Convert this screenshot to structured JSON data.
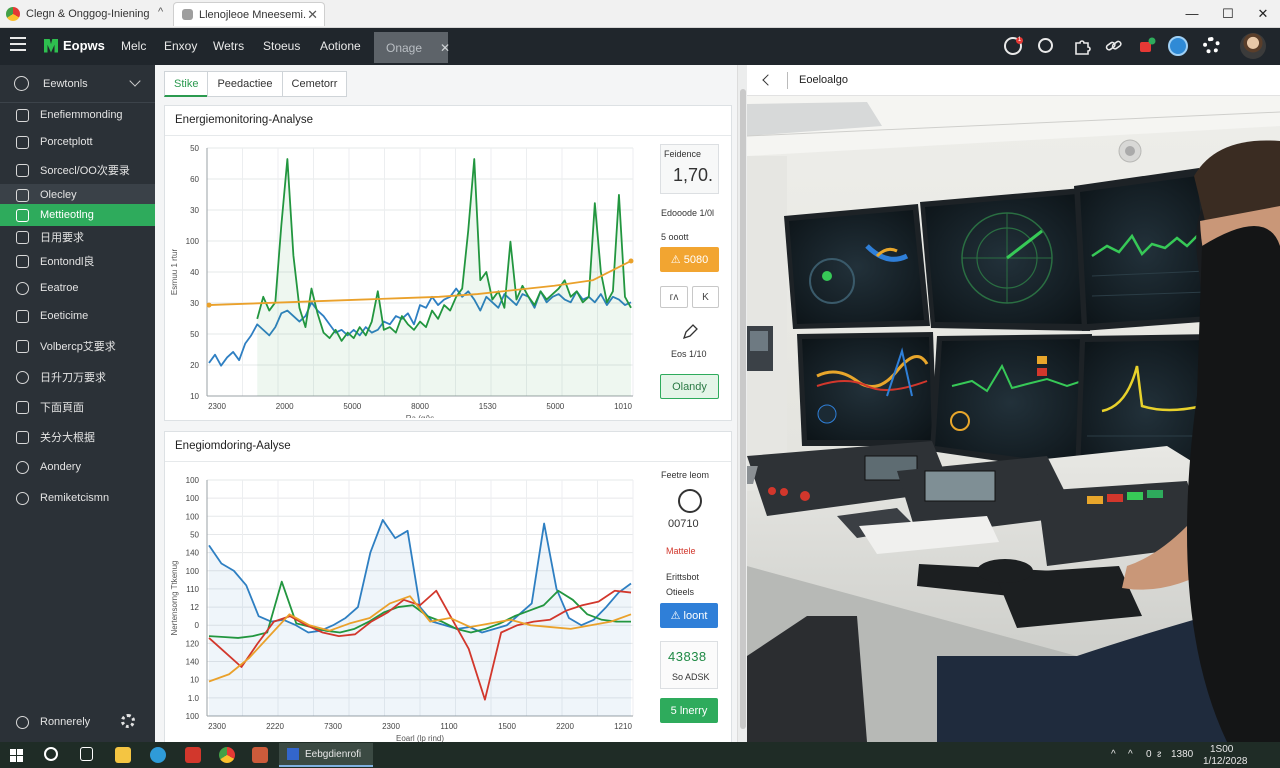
{
  "browser": {
    "tab1_title": "Clegn &  Onggog-Iniening",
    "tab2_title": "Llenojleoe Mneesemi.",
    "caret": "^",
    "window_controls": [
      "—",
      "☐",
      "✕"
    ]
  },
  "appbar": {
    "brand": "Eopws",
    "nav": [
      "Melc",
      "Enxoy",
      "Wetrs",
      "Stoeus",
      "Aotione"
    ],
    "active_tab": "Onage",
    "active_tab_close": "✕",
    "notification_badge": "1"
  },
  "sidebar": {
    "header": "Eewtonls",
    "items": [
      {
        "label": "Enefiemmonding",
        "icon": "pen-icon"
      },
      {
        "label": "Porcetplott",
        "icon": "chart-icon"
      },
      {
        "label": "Sorcecl/OO次要录",
        "icon": "list-icon"
      },
      {
        "label": "Olecley",
        "icon": "bell-icon"
      },
      {
        "label": "Mettieotlng",
        "icon": "monitor-icon"
      },
      {
        "label": "日用要求",
        "icon": "table-icon"
      },
      {
        "label": "Eontondl良",
        "icon": "doc-icon"
      },
      {
        "label": "Eeatroe",
        "icon": "globe-icon"
      },
      {
        "label": "Eoeticime",
        "icon": "clock-icon"
      },
      {
        "label": "Volbercp艾要求",
        "icon": "grid-icon"
      },
      {
        "label": "日升刀万要求",
        "icon": "user-icon"
      },
      {
        "label": "下面頁面",
        "icon": "image-icon"
      },
      {
        "label": "关分大根据",
        "icon": "settings-icon"
      },
      {
        "label": "Aondery",
        "icon": "home-icon"
      },
      {
        "label": "Remiketcismn",
        "icon": "help-icon"
      }
    ],
    "footer": "Ronnerely"
  },
  "main": {
    "subtabs": [
      "Stike",
      "Peedactiee",
      "Cemetorr"
    ],
    "card1": {
      "title": "Energiemonitoring-Analyse",
      "kpi_label": "Feidence",
      "kpi_value": "1,70.",
      "sub1": "Edooode 1/0l",
      "sub2": "5 ooott",
      "orange_button": "⚠ 5080",
      "icon_btn1": "ᴦᴧ",
      "icon_btn2": "K",
      "tool_label": "Eos  1/10",
      "green_button": "Olandy"
    },
    "card2": {
      "title": "Enegiomdoring-Aalyse",
      "panel_title": "Feetre leom",
      "ring_value": "00710",
      "status": "Mattele",
      "sub1": "Erittsbot",
      "sub2": "Otieels",
      "blue_button": "⚠ loont",
      "metric_value": "43838",
      "metric_sub": "So ADSK",
      "green_button": "5 lnerry"
    }
  },
  "photo_pane": {
    "title": "Eoeloalgo"
  },
  "taskbar": {
    "app_label": "Eebgdienrofi",
    "tray": [
      "^",
      "^",
      "0  ᴤ",
      "1380"
    ],
    "clock_time": "1S00 ",
    "clock_date": "1/12/2028"
  },
  "chart_data": [
    {
      "type": "line",
      "title": "Energiemonitoring-Analyse",
      "xlabel": "Ra (g/)s",
      "ylabel": "Esrnuu 1 rtur",
      "x_ticks": [
        "2300",
        "2000",
        "5000",
        "8000",
        "1530",
        "5000",
        "1010"
      ],
      "y_ticks": [
        "50",
        "60",
        "30",
        "100",
        "40",
        "30",
        "50",
        "20",
        "10"
      ],
      "ylim": [
        0,
        9
      ],
      "series": [
        {
          "color": "#2e7fc2",
          "values": [
            1.2,
            1.5,
            1.1,
            1.4,
            1.6,
            1.3,
            1.9,
            2.2,
            2.6,
            2.4,
            2.2,
            2.5,
            3.0,
            3.1,
            2.9,
            2.7,
            2.9,
            3.4,
            3.1,
            2.9,
            2.6,
            2.3,
            2.4,
            2.2,
            2.4,
            2.2,
            2.5,
            2.3,
            2.4,
            2.7,
            2.6,
            2.9,
            2.8,
            3.0,
            2.6,
            3.3,
            3.2,
            3.6,
            3.3,
            3.5,
            3.6,
            3.9,
            3.6,
            3.8,
            3.5,
            3.1,
            3.6,
            3.4,
            3.2,
            3.7,
            3.5,
            3.3,
            3.7,
            3.6,
            3.2,
            3.8,
            3.4,
            3.6,
            3.7,
            3.5,
            3.4,
            3.8,
            3.5,
            3.6,
            3.4,
            3.7,
            3.3,
            3.6,
            3.5,
            3.3,
            3.4
          ]
        },
        {
          "color": "#22963f",
          "values": [
            null,
            null,
            null,
            null,
            null,
            null,
            null,
            null,
            2.8,
            3.6,
            3.1,
            3.4,
            6.2,
            8.6,
            5.1,
            3.2,
            2.5,
            3.9,
            3.0,
            2.3,
            2.1,
            2.4,
            2.0,
            2.3,
            2.1,
            2.5,
            2.2,
            2.7,
            3.8,
            2.4,
            2.5,
            2.3,
            2.9,
            2.6,
            2.4,
            2.7,
            2.5,
            3.1,
            2.8,
            3.3,
            3.1,
            3.6,
            3.9,
            6.0,
            8.6,
            4.2,
            4.5,
            3.5,
            3.8,
            3.2,
            5.6,
            3.5,
            4.0,
            3.6,
            3.3,
            3.8,
            3.5,
            3.7,
            3.9,
            4.2,
            3.6,
            3.8,
            3.4,
            3.6,
            7.0,
            4.5,
            3.4,
            3.8,
            7.3,
            3.6,
            3.2
          ]
        },
        {
          "color": "#eaa12b",
          "values": [
            3.3,
            3.35,
            3.4,
            3.45,
            3.5,
            3.55,
            3.6,
            3.7,
            3.85,
            4.0,
            4.2,
            4.9
          ]
        }
      ]
    },
    {
      "type": "line",
      "title": "Enegiomdoring-Aalyse",
      "xlabel": "Eoarl (lp rind)",
      "ylabel": "Nertensorng Ttkenug",
      "x_ticks": [
        "2300",
        "2220",
        "7300",
        "2300",
        "1100",
        "1500",
        "2200",
        "1210"
      ],
      "y_ticks": [
        "100",
        "100",
        "100",
        "50",
        "140",
        "100",
        "110",
        "12",
        "0",
        "120",
        "140",
        "10",
        "1.0",
        "100"
      ],
      "ylim": [
        0,
        13
      ],
      "series": [
        {
          "color": "#2e7fc2",
          "values": [
            9.4,
            8.4,
            8.0,
            7.2,
            5.5,
            5.2,
            5.3,
            5.0,
            4.6,
            4.7,
            5.0,
            5.4,
            6.0,
            9.0,
            10.8,
            9.8,
            10.2,
            6.0,
            5.2,
            5.0,
            4.8,
            4.9,
            4.6,
            4.8,
            5.0,
            5.6,
            6.2,
            10.6,
            7.0,
            5.4,
            5.0,
            5.3,
            6.0,
            6.8,
            7.3
          ]
        },
        {
          "color": "#22963f",
          "values": [
            4.4,
            4.35,
            4.3,
            4.4,
            4.6,
            7.4,
            5.1,
            4.9,
            4.7,
            4.6,
            4.8,
            5.2,
            5.7,
            6.0,
            6.1,
            5.5,
            5.2,
            4.8,
            4.6,
            4.8,
            5.1,
            5.5,
            5.8,
            6.1,
            6.9,
            6.4,
            5.6,
            5.3,
            5.2,
            5.2
          ]
        },
        {
          "color": "#d2372c",
          "values": [
            4.3,
            3.5,
            2.7,
            4.0,
            5.2,
            5.5,
            5.0,
            4.6,
            4.4,
            4.5,
            5.2,
            5.7,
            6.4,
            6.1,
            6.9,
            5.3,
            3.7,
            0.9,
            4.6,
            5.0,
            5.2,
            5.3,
            5.8,
            6.1,
            6.3,
            6.9,
            6.8
          ]
        },
        {
          "color": "#eaa12b",
          "values": [
            1.9,
            2.3,
            3.2,
            4.4,
            5.6,
            5.0,
            4.7,
            5.1,
            5.4,
            6.2,
            6.6,
            5.2,
            5.4,
            4.9,
            5.1,
            5.3,
            5.0,
            4.9,
            4.8,
            5.0,
            5.2,
            5.6
          ]
        }
      ]
    }
  ]
}
